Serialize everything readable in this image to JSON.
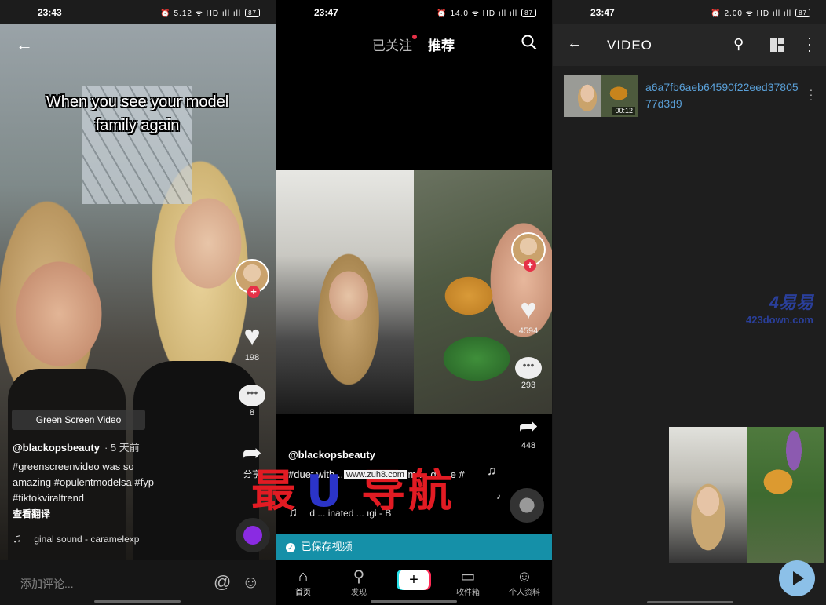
{
  "panel1": {
    "status": {
      "time": "23:43",
      "icons": "⏰ 5.12 ᯤ HD ıll ıll",
      "battery": "87"
    },
    "caption": "When you see your model family again",
    "likes": "198",
    "comments": "8",
    "share_label": "分享",
    "effect_chip": "Green Screen Video",
    "username": "@blackopsbeauty",
    "time_ago": "· 5 天前",
    "description": "#greenscreenvideo was so amazing #opulentmodelsa #fyp #tiktokviraltrend",
    "translate": "查看翻译",
    "music": "ginal sound - caramelexp",
    "comment_placeholder": "添加评论..."
  },
  "panel2": {
    "status": {
      "time": "23:47",
      "icons": "⏰ 14.0 ᯤ HD ıll ıll",
      "battery": "87"
    },
    "tab_following": "已关注",
    "tab_recommended": "推荐",
    "likes": "4594",
    "comments": "293",
    "shares": "448",
    "username": "@blackopsbeauty",
    "description": "#duet with ... thefa ... k no m ... d ... e #",
    "music": "d ... inated ... ıgi - B",
    "saved_toast": "已保存视频",
    "nav": [
      {
        "icon": "home-icon",
        "label": "首页"
      },
      {
        "icon": "search-icon",
        "label": "发现"
      },
      {
        "icon": "create-icon",
        "label": ""
      },
      {
        "icon": "inbox-icon",
        "label": "收件箱"
      },
      {
        "icon": "profile-icon",
        "label": "个人资料"
      }
    ]
  },
  "panel3": {
    "status": {
      "time": "23:47",
      "icons": "⏰ 2.00 ᯤ HD ıll ıll",
      "battery": "87"
    },
    "title": "VIDEO",
    "file": {
      "name": "a6a7fb6aeb64590f22eed3780577d3d9",
      "duration": "00:12"
    },
    "watermark_big": "4易易",
    "watermark_small": "423down.com"
  },
  "overlay": {
    "chars": [
      "最",
      "U",
      "导",
      "航"
    ],
    "url": "www.zuh8.com",
    "colors": [
      "#e21b23",
      "#2b34c8",
      "#e21b23",
      "#e21b23"
    ]
  }
}
